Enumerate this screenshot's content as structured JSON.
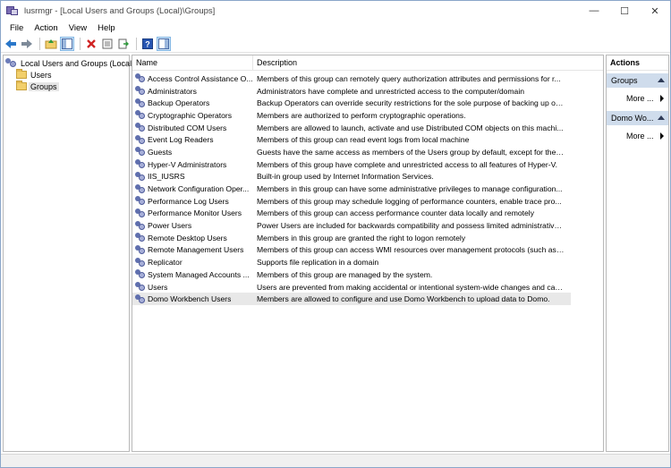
{
  "window": {
    "title": "lusrmgr - [Local Users and Groups (Local)\\Groups]",
    "controls": {
      "minimize": "—",
      "maximize": "☐",
      "close": "✕"
    }
  },
  "menu": {
    "items": [
      "File",
      "Action",
      "View",
      "Help"
    ]
  },
  "toolbar": {
    "icons": [
      "back-arrow-icon",
      "forward-arrow-icon",
      "up-folder-icon",
      "show-hide-tree-icon",
      "delete-icon",
      "properties-icon",
      "export-list-icon",
      "help-icon",
      "show-hide-action-pane-icon"
    ]
  },
  "tree": {
    "root": "Local Users and Groups (Local)",
    "children": [
      "Users",
      "Groups"
    ],
    "selected": "Groups"
  },
  "list": {
    "columns": {
      "name": "Name",
      "description": "Description"
    },
    "rows": [
      {
        "name": "Access Control Assistance O...",
        "description": "Members of this group can remotely query authorization attributes and permissions for r..."
      },
      {
        "name": "Administrators",
        "description": "Administrators have complete and unrestricted access to the computer/domain"
      },
      {
        "name": "Backup Operators",
        "description": "Backup Operators can override security restrictions for the sole purpose of backing up or ..."
      },
      {
        "name": "Cryptographic Operators",
        "description": "Members are authorized to perform cryptographic operations."
      },
      {
        "name": "Distributed COM Users",
        "description": "Members are allowed to launch, activate and use Distributed COM objects on this machi..."
      },
      {
        "name": "Event Log Readers",
        "description": "Members of this group can read event logs from local machine"
      },
      {
        "name": "Guests",
        "description": "Guests have the same access as members of the Users group by default, except for the Gu..."
      },
      {
        "name": "Hyper-V Administrators",
        "description": "Members of this group have complete and unrestricted access to all features of Hyper-V."
      },
      {
        "name": "IIS_IUSRS",
        "description": "Built-in group used by Internet Information Services."
      },
      {
        "name": "Network Configuration Oper...",
        "description": "Members in this group can have some administrative privileges to manage configuration..."
      },
      {
        "name": "Performance Log Users",
        "description": "Members of this group may schedule logging of performance counters, enable trace pro..."
      },
      {
        "name": "Performance Monitor Users",
        "description": "Members of this group can access performance counter data locally and remotely"
      },
      {
        "name": "Power Users",
        "description": "Power Users are included for backwards compatibility and possess limited administrative ..."
      },
      {
        "name": "Remote Desktop Users",
        "description": "Members in this group are granted the right to logon remotely"
      },
      {
        "name": "Remote Management Users",
        "description": "Members of this group can access WMI resources over management protocols (such as ..."
      },
      {
        "name": "Replicator",
        "description": "Supports file replication in a domain"
      },
      {
        "name": "System Managed Accounts ...",
        "description": "Members of this group are managed by the system."
      },
      {
        "name": "Users",
        "description": "Users are prevented from making accidental or intentional system-wide changes and can..."
      },
      {
        "name": "Domo Workbench Users",
        "description": "Members are allowed to configure and use Domo Workbench to upload data to Domo."
      }
    ],
    "selected_index": 18
  },
  "actions": {
    "title": "Actions",
    "sections": [
      {
        "label": "Groups",
        "more": "More ..."
      },
      {
        "label": "Domo Wo...",
        "more": "More ..."
      }
    ]
  },
  "colors": {
    "action_section_bg": "#cfdcec",
    "selection_bg": "#e8e8e8",
    "pane_border": "#b9b9b9"
  }
}
